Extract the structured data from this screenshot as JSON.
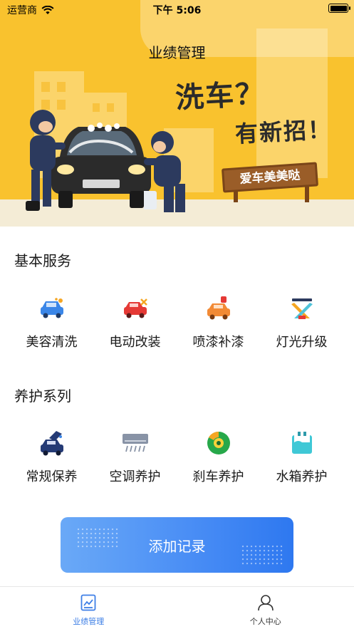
{
  "status_bar": {
    "carrier": "运营商",
    "time": "下午 5:06"
  },
  "header": {
    "title": "业绩管理"
  },
  "banner": {
    "line1": "洗车？",
    "line2": "有新招！",
    "sign": "爱车美美哒"
  },
  "sections": [
    {
      "title": "基本服务",
      "items": [
        {
          "label": "美容清洗",
          "icon": "car-wash-icon"
        },
        {
          "label": "电动改装",
          "icon": "car-modify-icon"
        },
        {
          "label": "喷漆补漆",
          "icon": "car-paint-icon"
        },
        {
          "label": "灯光升级",
          "icon": "light-upgrade-icon"
        }
      ]
    },
    {
      "title": "养护系列",
      "items": [
        {
          "label": "常规保养",
          "icon": "car-maintenance-icon"
        },
        {
          "label": "空调养护",
          "icon": "air-conditioner-icon"
        },
        {
          "label": "刹车养护",
          "icon": "brake-disc-icon"
        },
        {
          "label": "水箱养护",
          "icon": "water-tank-icon"
        }
      ]
    }
  ],
  "add_button": {
    "label": "添加记录"
  },
  "tabbar": {
    "tabs": [
      {
        "label": "业绩管理",
        "active": true
      },
      {
        "label": "个人中心",
        "active": false
      }
    ]
  },
  "colors": {
    "accent": "#3e7fe6",
    "banner": "#f9c22e",
    "button_start": "#6aa9f7",
    "button_end": "#2e78f0"
  }
}
